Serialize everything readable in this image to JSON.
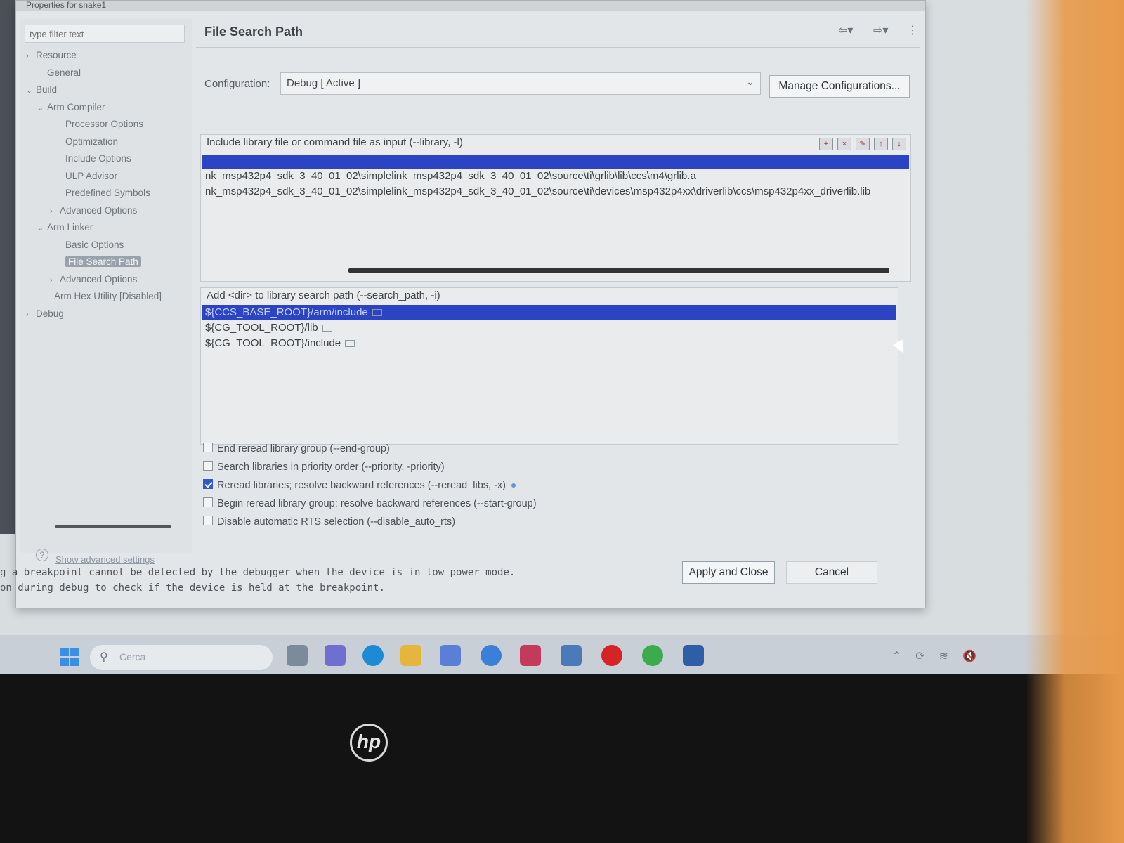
{
  "window": {
    "title": "Properties for snake1"
  },
  "filter": {
    "placeholder": "type filter text"
  },
  "tree": [
    {
      "label": "Resource",
      "chevron": "›"
    },
    {
      "label": "General",
      "chevron": ""
    },
    {
      "label": "Build",
      "chevron": "⌄"
    },
    {
      "label": "Arm Compiler",
      "chevron": "⌄"
    },
    {
      "label": "Processor Options",
      "chevron": ""
    },
    {
      "label": "Optimization",
      "chevron": ""
    },
    {
      "label": "Include Options",
      "chevron": ""
    },
    {
      "label": "ULP Advisor",
      "chevron": ""
    },
    {
      "label": "Predefined Symbols",
      "chevron": ""
    },
    {
      "label": "Advanced Options",
      "chevron": "›"
    },
    {
      "label": "Arm Linker",
      "chevron": "⌄"
    },
    {
      "label": "Basic Options",
      "chevron": ""
    },
    {
      "label": "File Search Path",
      "chevron": ""
    },
    {
      "label": "Advanced Options",
      "chevron": "›"
    },
    {
      "label": "Arm Hex Utility  [Disabled]",
      "chevron": ""
    },
    {
      "label": "Debug",
      "chevron": "›"
    }
  ],
  "advanced_link": "Show advanced settings",
  "page": {
    "title": "File Search Path"
  },
  "config": {
    "label": "Configuration:",
    "value": "Debug  [ Active ]",
    "manage": "Manage Configurations..."
  },
  "library_group": {
    "header": "Include library file or command file as input (--library, -l)",
    "items": [
      "nk_msp432p4_sdk_3_40_01_02\\simplelink_msp432p4_sdk_3_40_01_02\\source\\ti\\grlib\\lib\\ccs\\m4\\grlib.a",
      "nk_msp432p4_sdk_3_40_01_02\\simplelink_msp432p4_sdk_3_40_01_02\\source\\ti\\devices\\msp432p4xx\\driverlib\\ccs\\msp432p4xx_driverlib.lib"
    ]
  },
  "search_group": {
    "header": "Add <dir> to library search path (--search_path, -i)",
    "items": [
      "${CCS_BASE_ROOT}/arm/include",
      "${CG_TOOL_ROOT}/lib",
      "${CG_TOOL_ROOT}/include"
    ]
  },
  "options": [
    {
      "label": "End reread library group (--end-group)",
      "checked": false
    },
    {
      "label": "Search libraries in priority order (--priority, -priority)",
      "checked": false
    },
    {
      "label": "Reread libraries; resolve backward references (--reread_libs, -x)",
      "checked": true
    },
    {
      "label": "Begin reread library group; resolve backward references (--start-group)",
      "checked": false
    },
    {
      "label": "Disable automatic RTS selection (--disable_auto_rts)",
      "checked": false
    }
  ],
  "buttons": {
    "apply": "Apply and Close",
    "cancel": "Cancel"
  },
  "console": [
    "g a breakpoint cannot be detected by the debugger when the device is in low power mode.",
    "on during debug to check if the device is held at the breakpoint."
  ],
  "taskbar": {
    "search_placeholder": "Cerca"
  },
  "icons": [
    "search-icon",
    "back-icon",
    "forward-icon",
    "menu-icon",
    "add-icon",
    "delete-icon",
    "edit-icon",
    "move-up-icon",
    "move-down-icon",
    "help-icon"
  ],
  "colors": {
    "selection": "#2a44c4",
    "dialog_bg": "#e3e6e8",
    "accent_orange": "#e89a4a"
  }
}
